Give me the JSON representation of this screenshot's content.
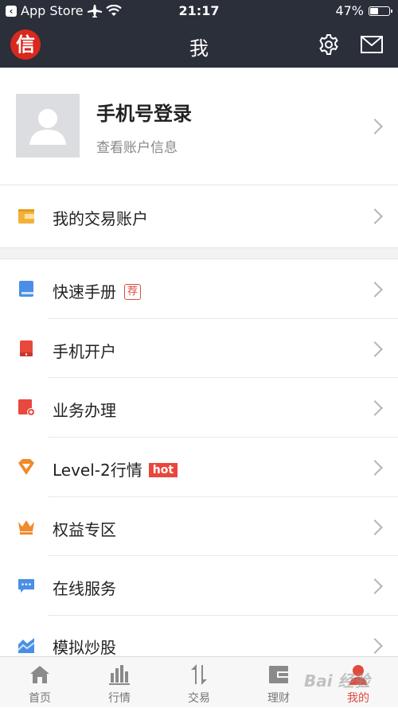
{
  "status_bar": {
    "back_label": "App Store",
    "time": "21:17",
    "battery": "47%",
    "battery_level": 0.47
  },
  "nav": {
    "logo_char": "信",
    "title": "我"
  },
  "profile": {
    "name": "手机号登录",
    "subtitle": "查看账户信息"
  },
  "account_row": {
    "label": "我的交易账户"
  },
  "menu": [
    {
      "label": "快速手册",
      "badge": "荐"
    },
    {
      "label": "手机开户"
    },
    {
      "label": "业务办理"
    },
    {
      "label": "Level-2行情",
      "badge": "hot"
    },
    {
      "label": "权益专区"
    },
    {
      "label": "在线服务"
    },
    {
      "label": "模拟炒股"
    }
  ],
  "tabs": [
    {
      "label": "首页",
      "icon": "home-icon"
    },
    {
      "label": "行情",
      "icon": "market-icon"
    },
    {
      "label": "交易",
      "icon": "trade-icon"
    },
    {
      "label": "理财",
      "icon": "wallet-icon"
    },
    {
      "label": "我的",
      "icon": "person-icon",
      "active": true
    }
  ],
  "watermark": "Bai 经验",
  "colors": {
    "header_bg": "#2b2f3a",
    "accent": "#e04a3f",
    "hot": "#e8473c"
  }
}
